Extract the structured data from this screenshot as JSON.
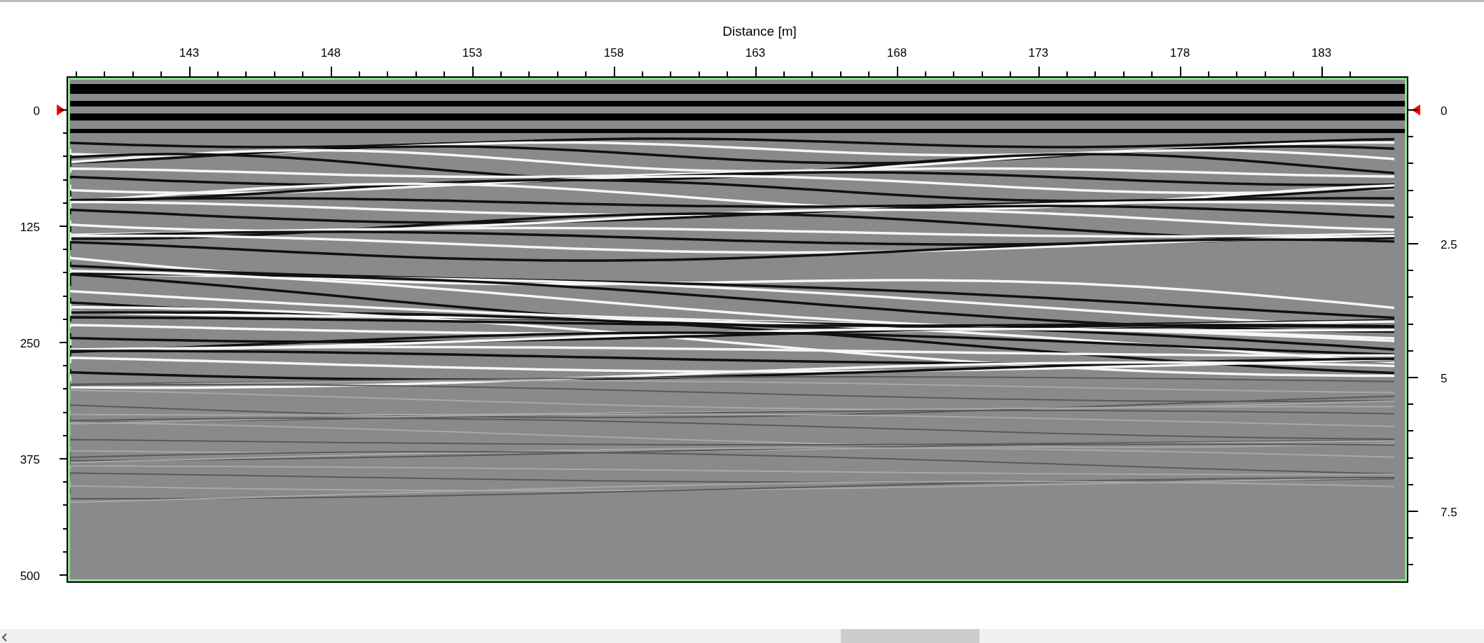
{
  "plot": {
    "title": "Distance [m]",
    "top_axis_labels": [
      "143",
      "148",
      "153",
      "158",
      "163",
      "168",
      "173",
      "178",
      "183"
    ],
    "left_axis_labels": [
      "0",
      "125",
      "250",
      "375",
      "500"
    ],
    "right_axis_labels": [
      "0",
      "2.5",
      "5",
      "7.5"
    ]
  }
}
